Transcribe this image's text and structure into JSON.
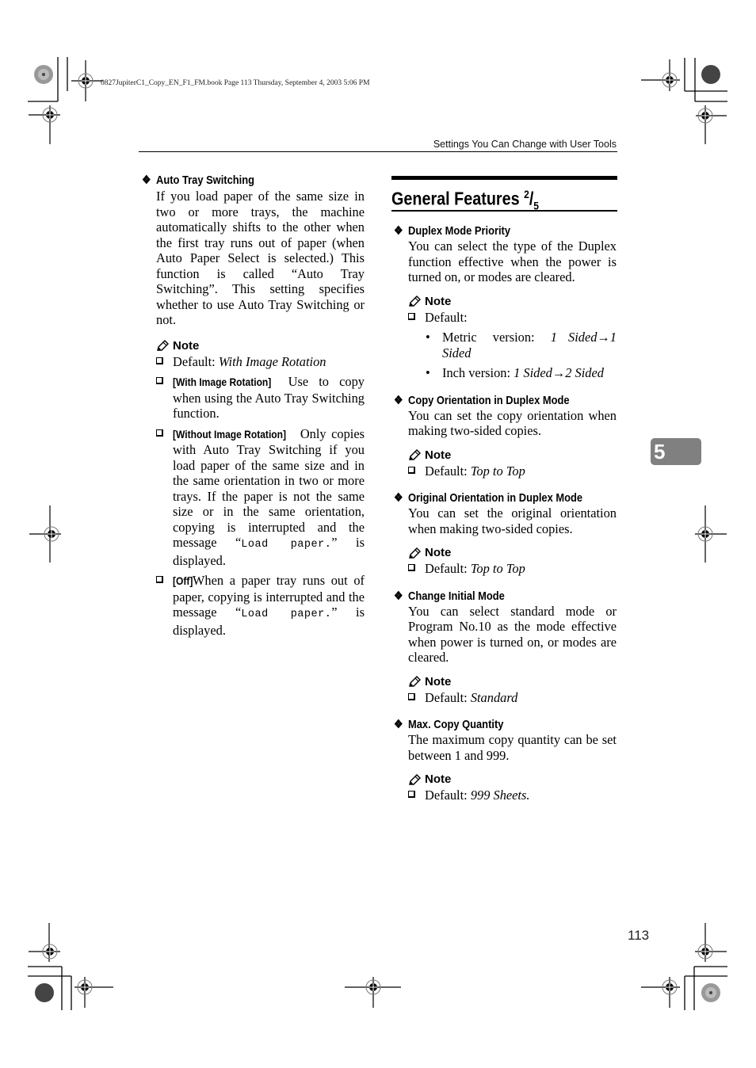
{
  "meta": {
    "file_line": "0827JupiterC1_Copy_EN_F1_FM.book  Page 113  Thursday, September 4, 2003  5:06 PM"
  },
  "header": {
    "running_title": "Settings You Can Change with User Tools"
  },
  "chapter_tab": "5",
  "page_number": "113",
  "left_column": {
    "item": {
      "title": "Auto Tray Switching",
      "body": "If you load paper of the same size in two or more trays, the machine automatically shifts to the other when the first tray runs out of pa­per (when Auto Paper Select is se­lected.) This function is called “Auto Tray Switching”. This set­ting specifies whether to use Auto Tray Switching or not.",
      "note_label": "Note",
      "notes": [
        {
          "prefix": "Default: ",
          "value": "With Image Rotation"
        },
        {
          "key": "[With Image Rotation]",
          "text": " Use to copy when using the Auto Tray Switching function."
        },
        {
          "key": "[Without Image Rotation]",
          "text_a": " Only copies with Auto Tray Switch­ing if you load paper of the same size and in the same orien­tation in two or more trays. If the paper is not the same size or in the same orientation, copying is interrupted and the message “",
          "message": "Load paper.",
          "text_b": "” is displayed."
        },
        {
          "key": "[Off]",
          "text_a": " When a paper tray runs out of paper, copying is interrupted and the message “",
          "message": "Load pa­per.",
          "text_b": "” is displayed."
        }
      ]
    }
  },
  "right_column": {
    "section_title": "General Features",
    "section_page_num": "2",
    "section_page_den": "5",
    "items": [
      {
        "title": "Duplex Mode Priority",
        "body": "You can select the type of the Du­plex function effective when the power is turned on, or modes are cleared.",
        "note_label": "Note",
        "default_prefix": "Default:",
        "bullets": [
          {
            "label": "Metric version: ",
            "value": "1 Sided→1 Sided"
          },
          {
            "label": "Inch version: ",
            "value": "1 Sided→2 Sided"
          }
        ]
      },
      {
        "title": "Copy Orientation in Duplex Mode",
        "body": "You can set the copy orientation when making two-sided copies.",
        "note_label": "Note",
        "default_prefix": "Default: ",
        "default_value": "Top to Top"
      },
      {
        "title": "Original Orientation in Duplex Mode",
        "body": "You can set the original orientation when making two-sided copies.",
        "note_label": "Note",
        "default_prefix": "Default: ",
        "default_value": "Top to Top"
      },
      {
        "title": "Change Initial Mode",
        "body": "You can select standard mode or Program No.10 as the mode effec­tive when power is turned on, or modes are cleared.",
        "note_label": "Note",
        "default_prefix": "Default: ",
        "default_value": "Standard"
      },
      {
        "title": "Max. Copy Quantity",
        "body": "The maximum copy quantity can be set between 1 and 999.",
        "note_label": "Note",
        "default_prefix": "Default: ",
        "default_value": "999 Sheets."
      }
    ]
  },
  "icons": {
    "diamond": "❖"
  }
}
